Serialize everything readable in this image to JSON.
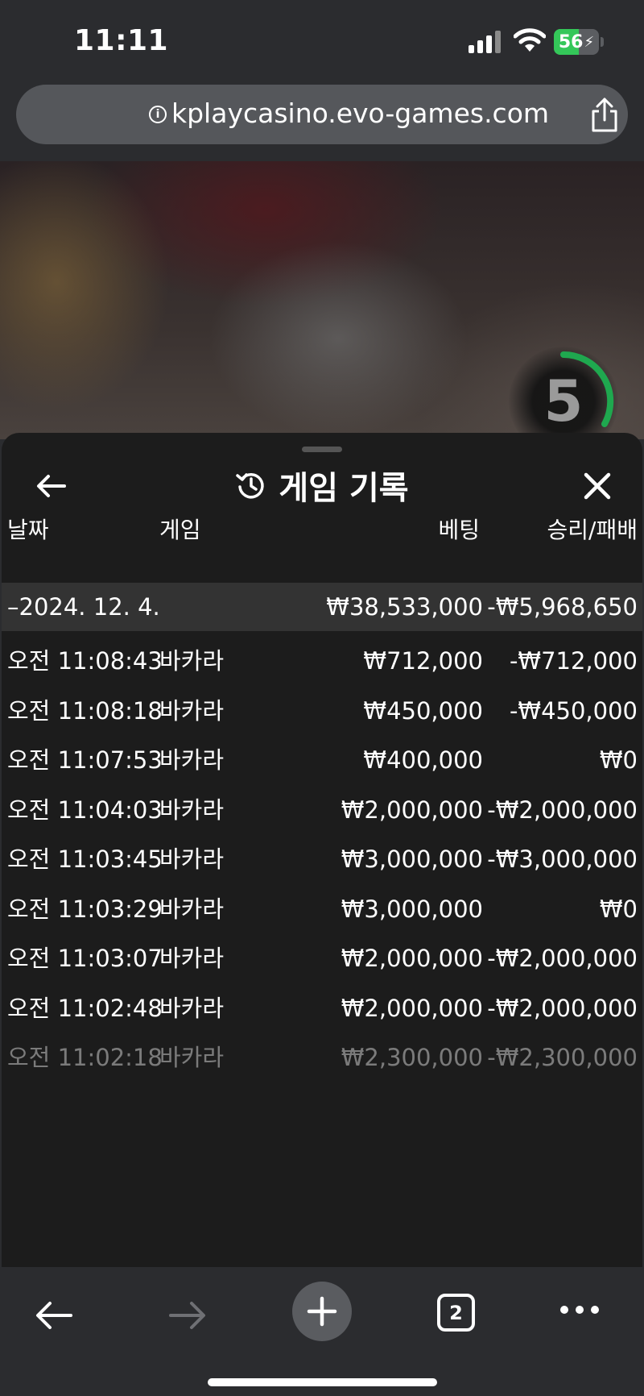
{
  "status_bar": {
    "time": "11:11",
    "battery_level": "56",
    "battery_fill_fraction": 0.56
  },
  "browser": {
    "url": "kplaycasino.evo-games.com",
    "tab_count": "2"
  },
  "video": {
    "timer_value": "5"
  },
  "panel": {
    "title": "게임 기록",
    "columns": {
      "date": "날짜",
      "game": "게임",
      "bet": "베팅",
      "win_loss": "승리/패배"
    },
    "summary": {
      "date": "–2024. 12. 4.",
      "bet": "₩38,533,000",
      "win_loss": "-₩5,968,650"
    },
    "rows": [
      {
        "time": "오전 11:08:43",
        "game": "바카라",
        "bet": "₩712,000",
        "win_loss": "-₩712,000"
      },
      {
        "time": "오전 11:08:18",
        "game": "바카라",
        "bet": "₩450,000",
        "win_loss": "-₩450,000"
      },
      {
        "time": "오전 11:07:53",
        "game": "바카라",
        "bet": "₩400,000",
        "win_loss": "₩0"
      },
      {
        "time": "오전 11:04:03",
        "game": "바카라",
        "bet": "₩2,000,000",
        "win_loss": "-₩2,000,000"
      },
      {
        "time": "오전 11:03:45",
        "game": "바카라",
        "bet": "₩3,000,000",
        "win_loss": "-₩3,000,000"
      },
      {
        "time": "오전 11:03:29",
        "game": "바카라",
        "bet": "₩3,000,000",
        "win_loss": "₩0"
      },
      {
        "time": "오전 11:03:07",
        "game": "바카라",
        "bet": "₩2,000,000",
        "win_loss": "-₩2,000,000"
      },
      {
        "time": "오전 11:02:48",
        "game": "바카라",
        "bet": "₩2,000,000",
        "win_loss": "-₩2,000,000"
      },
      {
        "time": "오전 11:02:18",
        "game": "바카라",
        "bet": "₩2,300,000",
        "win_loss": "-₩2,300,000"
      }
    ]
  },
  "icons": {
    "back": "arrow-left-icon",
    "close": "close-icon",
    "history": "history-icon",
    "share": "share-icon",
    "info": "info-icon"
  },
  "colors": {
    "timer_ring": "#1fa84f",
    "battery": "#34c759",
    "panel_bg": "#1c1c1c",
    "summary_bg": "#333333"
  }
}
